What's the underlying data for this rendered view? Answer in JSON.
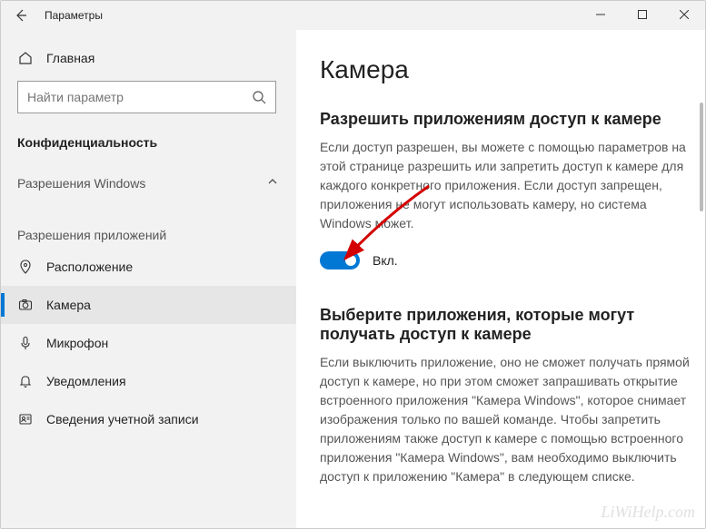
{
  "titlebar": {
    "title": "Параметры"
  },
  "sidebar": {
    "home": "Главная",
    "search_placeholder": "Найти параметр",
    "category": "Конфиденциальность",
    "group1": "Разрешения Windows",
    "group2": "Разрешения приложений",
    "items": [
      {
        "label": "Расположение"
      },
      {
        "label": "Камера"
      },
      {
        "label": "Микрофон"
      },
      {
        "label": "Уведомления"
      },
      {
        "label": "Сведения учетной записи"
      }
    ]
  },
  "main": {
    "page_title": "Камера",
    "section1_title": "Разрешить приложениям доступ к камере",
    "section1_desc": "Если доступ разрешен, вы можете с помощью параметров на этой странице разрешить или запретить доступ к камере для каждого конкретного приложения. Если доступ запрещен, приложения не могут использовать камеру, но система Windows может.",
    "toggle_state": "Вкл.",
    "section2_title": "Выберите приложения, которые могут получать доступ к камере",
    "section2_desc": "Если выключить приложение, оно не сможет получать прямой доступ к камере, но при этом сможет запрашивать открытие встроенного приложения \"Камера Windows\", которое снимает изображения только по вашей команде. Чтобы запретить приложениям также доступ к камере с помощью встроенного приложения \"Камера Windows\", вам необходимо выключить доступ к приложению \"Камера\" в следующем списке."
  },
  "watermark": "LiWiHelp.com"
}
